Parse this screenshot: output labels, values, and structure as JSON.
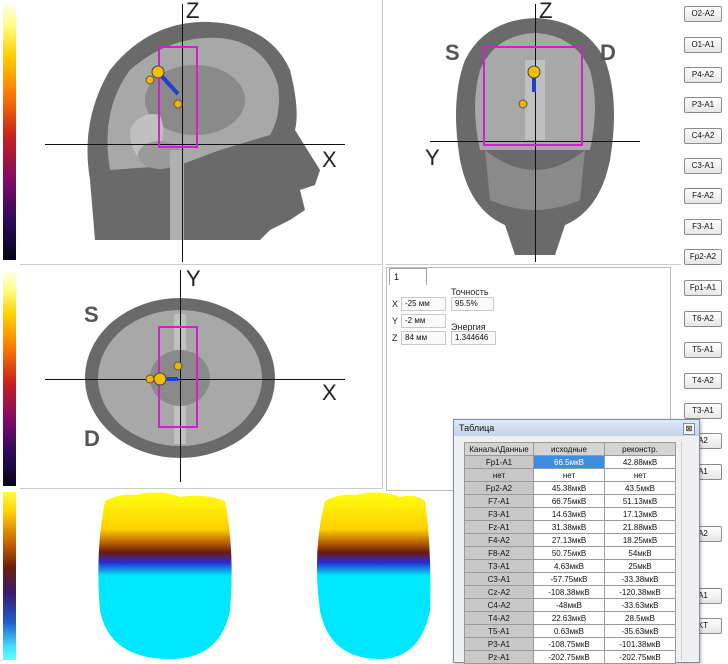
{
  "views": {
    "sagittal": {
      "axis_v": "Z",
      "axis_h": "X"
    },
    "coronal": {
      "axis_v": "Z",
      "axis_h": "Y",
      "left": "S",
      "right": "D"
    },
    "axial": {
      "axis_v": "Y",
      "axis_h": "X",
      "top": "S",
      "bottom": "D"
    }
  },
  "channels": [
    "O2-A2",
    "O1-A1",
    "P4-A2",
    "P3-A1",
    "C4-A2",
    "C3-A1",
    "F4-A2",
    "F3-A1",
    "Fp2-A2",
    "Fp1-A1",
    "T6-A2",
    "T5-A1",
    "T4-A2",
    "T3-A1",
    "A2",
    "A1",
    "A2",
    "A1",
    "KT"
  ],
  "info": {
    "tab": "1",
    "accuracy_label": "Точность",
    "accuracy_value": "95.5%",
    "x_label": "X",
    "x_value": "-25 мм",
    "y_label": "Y",
    "y_value": "-2 мм",
    "z_label": "Z",
    "z_value": "84 мм",
    "energy_label": "Энергия",
    "energy_value": "1.344646"
  },
  "table_window": {
    "title": "Таблица",
    "close": "⊠",
    "headers": [
      "Каналы\\Данные",
      "исходные",
      "реконстр."
    ],
    "rows": [
      [
        "Fp1-A1",
        "66.5мкВ",
        "42.88мкВ"
      ],
      [
        "нет",
        "нет",
        "нет"
      ],
      [
        "Fp2-A2",
        "45.38мкВ",
        "43.5мкВ"
      ],
      [
        "F7-A1",
        "66.75мкВ",
        "51.13мкВ"
      ],
      [
        "F3-A1",
        "14.63мкВ",
        "17.13мкВ"
      ],
      [
        "Fz-A1",
        "31.38мкВ",
        "21.88мкВ"
      ],
      [
        "F4-A2",
        "27.13мкВ",
        "18.25мкВ"
      ],
      [
        "F8-A2",
        "50.75мкВ",
        "54мкВ"
      ],
      [
        "T3-A1",
        "4.63мкВ",
        "25мкВ"
      ],
      [
        "C3-A1",
        "-57.75мкВ",
        "-33.38мкВ"
      ],
      [
        "Cz-A2",
        "-108.38мкВ",
        "-120.38мкВ"
      ],
      [
        "C4-A2",
        "-48мкВ",
        "-33.63мкВ"
      ],
      [
        "T4-A2",
        "22.63мкВ",
        "28.5мкВ"
      ],
      [
        "T5-A1",
        "0.63мкВ",
        "-35.63мкВ"
      ],
      [
        "P3-A1",
        "-108.75мкВ",
        "-101.38мкВ"
      ],
      [
        "Pz-A1",
        "-202.75мкВ",
        "-202.75мкВ"
      ]
    ]
  },
  "colors": {
    "selection": "#3d8ee0",
    "marker": "#d020d0",
    "dipole": "#1f3fd0",
    "source": "#f0b400"
  }
}
